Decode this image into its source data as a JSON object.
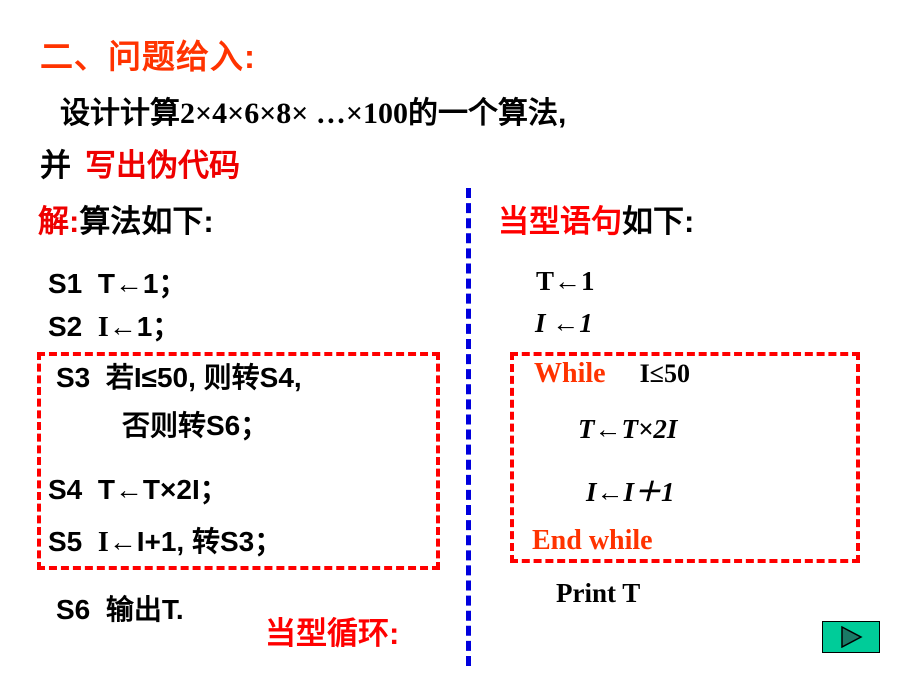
{
  "slide": {
    "title": "二、问题给入:",
    "problem": {
      "prefix_cjk": "设计计算",
      "expression": "2×4×6×8× …×100",
      "suffix_cjk": "的一个算法,",
      "line2_lead": "并",
      "line2_highlight": "写出伪代码"
    }
  },
  "left": {
    "heading_highlight": "解:",
    "heading_rest": "算法如下:",
    "steps": [
      {
        "tag": "S1",
        "body": "T←1；",
        "var": ""
      },
      {
        "tag": "S2",
        "body": "←1；",
        "var": "I"
      },
      {
        "tag": "S3",
        "body": "若I≤50, 则转S4,",
        "var": ""
      },
      {
        "tag": "",
        "body": "否则转S6；",
        "var": ""
      },
      {
        "tag": "S4",
        "body": "T←T×2I；",
        "var": ""
      },
      {
        "tag": "S5",
        "body": "←I+1, 转S3；",
        "var": "I"
      },
      {
        "tag": "S6",
        "body": "输出T.",
        "var": ""
      }
    ],
    "note": "当型循环:"
  },
  "right": {
    "heading_highlight": "当型语句",
    "heading_rest": "如下:",
    "init": [
      "T←1",
      "I ←1"
    ],
    "while_keyword": "While",
    "while_condition": "I≤50",
    "body": [
      "T←T×2I",
      "I←I＋1"
    ],
    "end_keyword": "End while",
    "print": "Print T"
  },
  "controls": {
    "play_button_label": "play-triangle"
  },
  "colors": {
    "title_red": "#ff3300",
    "highlight_red": "#ee0000",
    "box_red": "#ff0000",
    "divider_blue": "#0000dd",
    "button_green": "#00cc99",
    "button_triangle": "#006655"
  }
}
